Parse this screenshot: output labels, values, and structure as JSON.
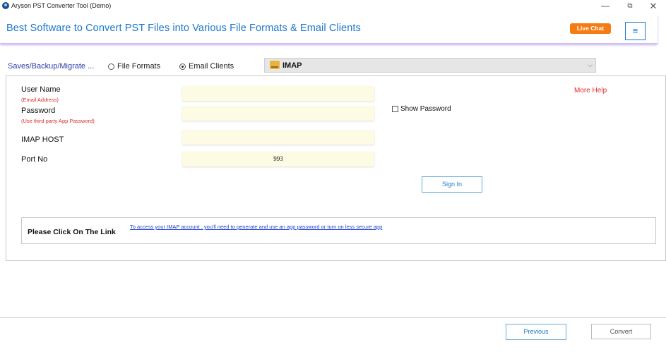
{
  "window": {
    "title": "Aryson PST Converter Tool (Demo)",
    "controls": {
      "minimize": "—",
      "restore": "⧉",
      "close": "✕"
    }
  },
  "header": {
    "title": "Best Software to Convert PST Files into Various File Formats & Email Clients",
    "live_chat": "Live Chat",
    "menu_icon": "≡"
  },
  "mode": {
    "label": "Saves/Backup/Migrate ...",
    "options": [
      {
        "label": "File Formats",
        "selected": false
      },
      {
        "label": "Email Clients",
        "selected": true
      }
    ],
    "client_selected": "IMAP",
    "client_icon": "envelope-icon",
    "dropdown_arrow": "⌵"
  },
  "form": {
    "username_label": "User Name",
    "username_hint": "(Email Address)",
    "username_value": "",
    "password_label": "Password",
    "password_hint": "(Use third party App Password)",
    "password_value": "",
    "imap_host_label": "IMAP HOST",
    "imap_host_value": "",
    "port_label": "Port No",
    "port_value": "993",
    "more_help": "More Help",
    "show_password": "Show Password",
    "show_password_checked": false,
    "sign_in": "Sign In"
  },
  "link_box": {
    "label": "Please Click On The Link",
    "link_text": "To access your IMAP account , you'll need to generate and use an app password or turn on less secure app"
  },
  "footer": {
    "previous": "Previous",
    "convert": "Convert"
  },
  "colors": {
    "brand_blue": "#1c78c9",
    "live_chat_orange": "#f57c12",
    "hint_red": "#e12b2b",
    "field_bg": "#fdfbe3"
  }
}
